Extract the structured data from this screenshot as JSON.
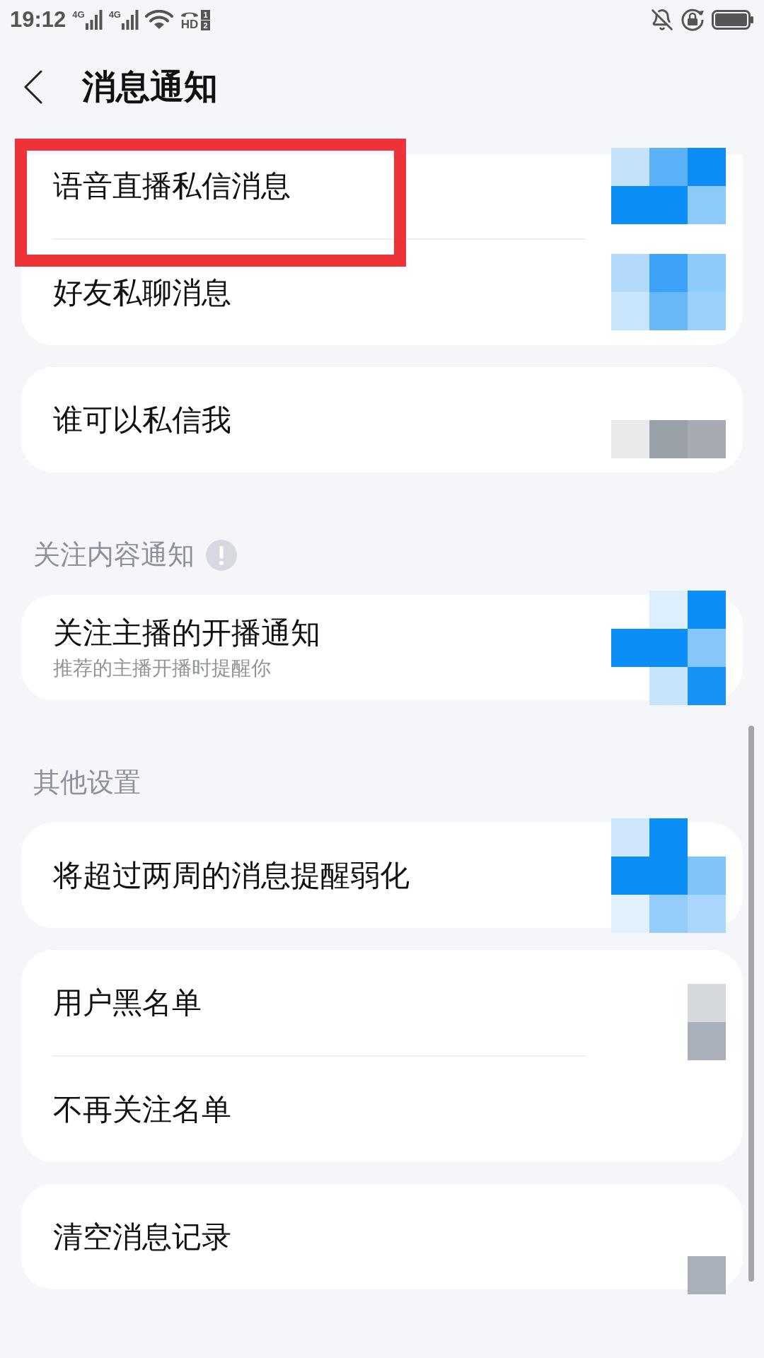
{
  "status_bar": {
    "time": "19:12",
    "signals": [
      {
        "label": "4G"
      },
      {
        "label": "4G"
      }
    ],
    "hd_badge": {
      "label": "HD",
      "sims": [
        "1",
        "2"
      ]
    }
  },
  "header": {
    "title": "消息通知"
  },
  "sections": [
    {
      "cards": [
        {
          "items": [
            {
              "label": "语音直播私信消息",
              "highlighted": true,
              "mosaic": [
                [
                  {
                    "kind": "tile",
                    "color": "#c5e2fb"
                  },
                  {
                    "kind": "tile",
                    "color": "#5ab1f6"
                  },
                  {
                    "kind": "tile",
                    "color": "#0b8ff7"
                  }
                ],
                [
                  {
                    "kind": "tile",
                    "color": "#0b8ff7"
                  },
                  {
                    "kind": "tile",
                    "color": "#0b8ff7"
                  },
                  {
                    "kind": "tile",
                    "color": "#8ccafa"
                  }
                ]
              ]
            },
            {
              "label": "好友私聊消息",
              "highlighted": false,
              "mosaic": [
                [
                  {
                    "kind": "tile",
                    "color": "#b3dafb"
                  },
                  {
                    "kind": "tile",
                    "color": "#3ba2f7"
                  },
                  {
                    "kind": "tile",
                    "color": "#8ecbfa"
                  }
                ],
                [
                  {
                    "kind": "tile",
                    "color": "#c9e5fc"
                  },
                  {
                    "kind": "tile",
                    "color": "#6ab8f7"
                  },
                  {
                    "kind": "tile",
                    "color": "#9ad0fa"
                  }
                ]
              ]
            }
          ]
        },
        {
          "items": [
            {
              "label": "谁可以私信我",
              "highlighted": false,
              "mosaic": [
                [
                  {
                    "kind": "gap"
                  },
                  {
                    "kind": "gap"
                  },
                  {
                    "kind": "gap"
                  }
                ],
                [
                  {
                    "kind": "tile",
                    "color": "#e8e9eb"
                  },
                  {
                    "kind": "tile",
                    "color": "#9aa0a8"
                  },
                  {
                    "kind": "tile",
                    "color": "#a6abb3"
                  }
                ]
              ]
            }
          ]
        }
      ]
    },
    {
      "heading": "关注内容通知",
      "hint_icon": true,
      "cards": [
        {
          "items": [
            {
              "label": "关注主播的开播通知",
              "description": "推荐的主播开播时提醒你",
              "highlighted": false,
              "mosaic": [
                [
                  {
                    "kind": "gap"
                  },
                  {
                    "kind": "tile",
                    "color": "#ddeefd"
                  },
                  {
                    "kind": "tile",
                    "color": "#0b8ff7"
                  }
                ],
                [
                  {
                    "kind": "tile",
                    "color": "#0b8ff7"
                  },
                  {
                    "kind": "tile",
                    "color": "#0b8ff7"
                  },
                  {
                    "kind": "tile",
                    "color": "#86c6fa"
                  }
                ],
                [
                  {
                    "kind": "gap"
                  },
                  {
                    "kind": "tile",
                    "color": "#c8e4fc"
                  },
                  {
                    "kind": "tile",
                    "color": "#1793f7"
                  }
                ]
              ]
            }
          ]
        }
      ]
    },
    {
      "heading": "其他设置",
      "cards": [
        {
          "items": [
            {
              "label": "将超过两周的消息提醒弱化",
              "highlighted": false,
              "mosaic": [
                [
                  {
                    "kind": "tile",
                    "color": "#cfe7fc"
                  },
                  {
                    "kind": "tile",
                    "color": "#0b8ff7"
                  },
                  {
                    "kind": "gap"
                  }
                ],
                [
                  {
                    "kind": "tile",
                    "color": "#0b8ff7"
                  },
                  {
                    "kind": "tile",
                    "color": "#0b8ff7"
                  },
                  {
                    "kind": "tile",
                    "color": "#7fc3f9"
                  }
                ],
                [
                  {
                    "kind": "tile",
                    "color": "#e2f1fd"
                  },
                  {
                    "kind": "tile",
                    "color": "#95cdfa"
                  },
                  {
                    "kind": "tile",
                    "color": "#aad7fb"
                  }
                ]
              ]
            }
          ]
        },
        {
          "items": [
            {
              "label": "用户黑名单",
              "highlighted": false,
              "mosaic": [
                [
                  {
                    "kind": "gap"
                  },
                  {
                    "kind": "gap"
                  },
                  {
                    "kind": "gap"
                  }
                ],
                [
                  {
                    "kind": "gap"
                  },
                  {
                    "kind": "gap"
                  },
                  {
                    "kind": "tile",
                    "color": "#d5d8dc"
                  }
                ],
                [
                  {
                    "kind": "gap"
                  },
                  {
                    "kind": "gap"
                  },
                  {
                    "kind": "tile",
                    "color": "#aab0b9"
                  }
                ]
              ]
            },
            {
              "label": "不再关注名单",
              "highlighted": false
            }
          ]
        },
        {
          "items": [
            {
              "label": "清空消息记录",
              "highlighted": false,
              "mosaic": [
                [
                  {
                    "kind": "gap"
                  },
                  {
                    "kind": "gap"
                  },
                  {
                    "kind": "gap"
                  }
                ],
                [
                  {
                    "kind": "gap"
                  },
                  {
                    "kind": "gap"
                  },
                  {
                    "kind": "gap"
                  }
                ],
                [
                  {
                    "kind": "gap"
                  },
                  {
                    "kind": "gap"
                  },
                  {
                    "kind": "tile",
                    "color": "#aab0b9"
                  }
                ]
              ]
            }
          ]
        }
      ]
    }
  ]
}
